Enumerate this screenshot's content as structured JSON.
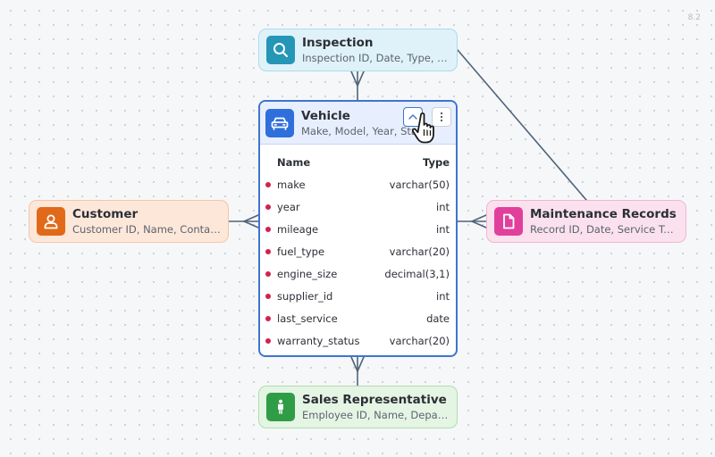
{
  "version": "8.2",
  "nodes": {
    "inspection": {
      "title": "Inspection",
      "subtitle": "Inspection ID, Date, Type, Result",
      "icon": "search-icon",
      "color": "#2596b6"
    },
    "customer": {
      "title": "Customer",
      "subtitle": "Customer ID, Name, Contact Info",
      "icon": "user-icon",
      "color": "#e06a19"
    },
    "maintenance": {
      "title": "Maintenance Records",
      "subtitle": "Record ID, Date, Service Type",
      "icon": "document-icon",
      "color": "#e0409c"
    },
    "sales": {
      "title": "Sales Representative",
      "subtitle": "Employee ID, Name, Department",
      "icon": "person-icon",
      "color": "#2f9d45"
    }
  },
  "vehicle": {
    "title": "Vehicle",
    "subtitle": "Make, Model, Year, Status",
    "icon": "car-icon",
    "color": "#2f6fdc",
    "col_name": "Name",
    "col_type": "Type",
    "fields": [
      {
        "name": "make",
        "type": "varchar(50)"
      },
      {
        "name": "year",
        "type": "int"
      },
      {
        "name": "mileage",
        "type": "int"
      },
      {
        "name": "fuel_type",
        "type": "varchar(20)"
      },
      {
        "name": "engine_size",
        "type": "decimal(3,1)"
      },
      {
        "name": "supplier_id",
        "type": "int"
      },
      {
        "name": "last_service",
        "type": "date"
      },
      {
        "name": "warranty_status",
        "type": "varchar(20)"
      }
    ]
  }
}
